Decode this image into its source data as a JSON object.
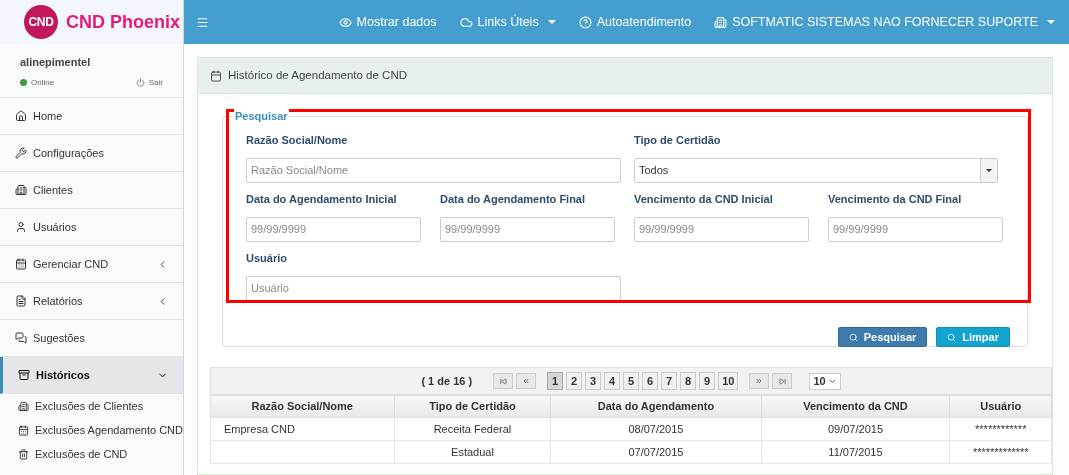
{
  "brand": {
    "logo_text": "CND",
    "name": "CND Phoenix"
  },
  "user": {
    "name": "alinepimentel",
    "status": "Online",
    "online": true,
    "logout": "Sair"
  },
  "sidebar": {
    "items": [
      {
        "label": "Home",
        "kind": "link",
        "selected": false
      },
      {
        "label": "Configurações",
        "kind": "link",
        "selected": false
      },
      {
        "label": "Clientes",
        "kind": "link",
        "selected": false
      },
      {
        "label": "Usuários",
        "kind": "link",
        "selected": false
      },
      {
        "label": "Gerenciar CND",
        "kind": "submenu",
        "selected": false,
        "expanded": false
      },
      {
        "label": "Relatórios",
        "kind": "submenu",
        "selected": false,
        "expanded": false
      },
      {
        "label": "Sugestões",
        "kind": "link",
        "selected": false
      },
      {
        "label": "Históricos",
        "kind": "submenu",
        "selected": true,
        "expanded": true,
        "children": [
          {
            "label": "Exclusões de Clientes"
          },
          {
            "label": "Exclusões Agendamento CND"
          },
          {
            "label": "Exclusões de CND"
          }
        ]
      }
    ]
  },
  "topbar": {
    "items": [
      {
        "label": "Mostrar dados",
        "kind": "link"
      },
      {
        "label": "Links Úteis",
        "kind": "dropdown"
      },
      {
        "label": "Autoatendimento",
        "kind": "link"
      },
      {
        "label": "SOFTMATIC SISTEMAS NAO FORNECER SUPORTE",
        "kind": "dropdown"
      }
    ]
  },
  "panel": {
    "title": "Histórico de Agendamento de CND",
    "search": {
      "legend": "Pesquisar",
      "fields": [
        {
          "kind": "wide",
          "label": "Razão Social/Nome",
          "placeholder": "Razão Social/Nome"
        },
        {
          "kind": "select",
          "label": "Tipo de Certidão",
          "value": "Todos"
        },
        {
          "kind": "date",
          "label": "Data do Agendamento Inicial",
          "placeholder": "99/99/9999"
        },
        {
          "kind": "date",
          "label": "Data do Agendamento Final",
          "placeholder": "99/99/9999"
        },
        {
          "kind": "date",
          "label": "Vencimento da CND Inicial",
          "placeholder": "99/99/9999"
        },
        {
          "kind": "date",
          "label": "Vencimento da CND Final",
          "placeholder": "99/99/9999"
        },
        {
          "kind": "wide",
          "label": "Usuário",
          "placeholder": "Usuário"
        }
      ],
      "buttons": [
        {
          "label": "Pesquisar",
          "kind": "primary"
        },
        {
          "label": "Limpar",
          "kind": "info"
        }
      ]
    },
    "pagination": {
      "summary": "( 1 de 16 )",
      "pages": [
        {
          "label": "1",
          "selected": true
        },
        {
          "label": "2",
          "selected": false
        },
        {
          "label": "3",
          "selected": false
        },
        {
          "label": "4",
          "selected": false
        },
        {
          "label": "5",
          "selected": false
        },
        {
          "label": "6",
          "selected": false
        },
        {
          "label": "7",
          "selected": false
        },
        {
          "label": "8",
          "selected": false
        },
        {
          "label": "9",
          "selected": false
        },
        {
          "label": "10",
          "selected": false
        }
      ],
      "page_size": "10"
    },
    "table": {
      "columns": [
        "Razão Social/Nome",
        "Tipo de Certidão",
        "Data do Agendamento",
        "Vencimento da CND",
        "Usuário"
      ],
      "rows": [
        [
          "Empresa CND",
          "Receita Federal",
          "08/07/2015",
          "09/07/2015",
          "************"
        ],
        [
          "",
          "Estadual",
          "07/07/2015",
          "11/07/2015",
          "*************"
        ]
      ]
    }
  }
}
